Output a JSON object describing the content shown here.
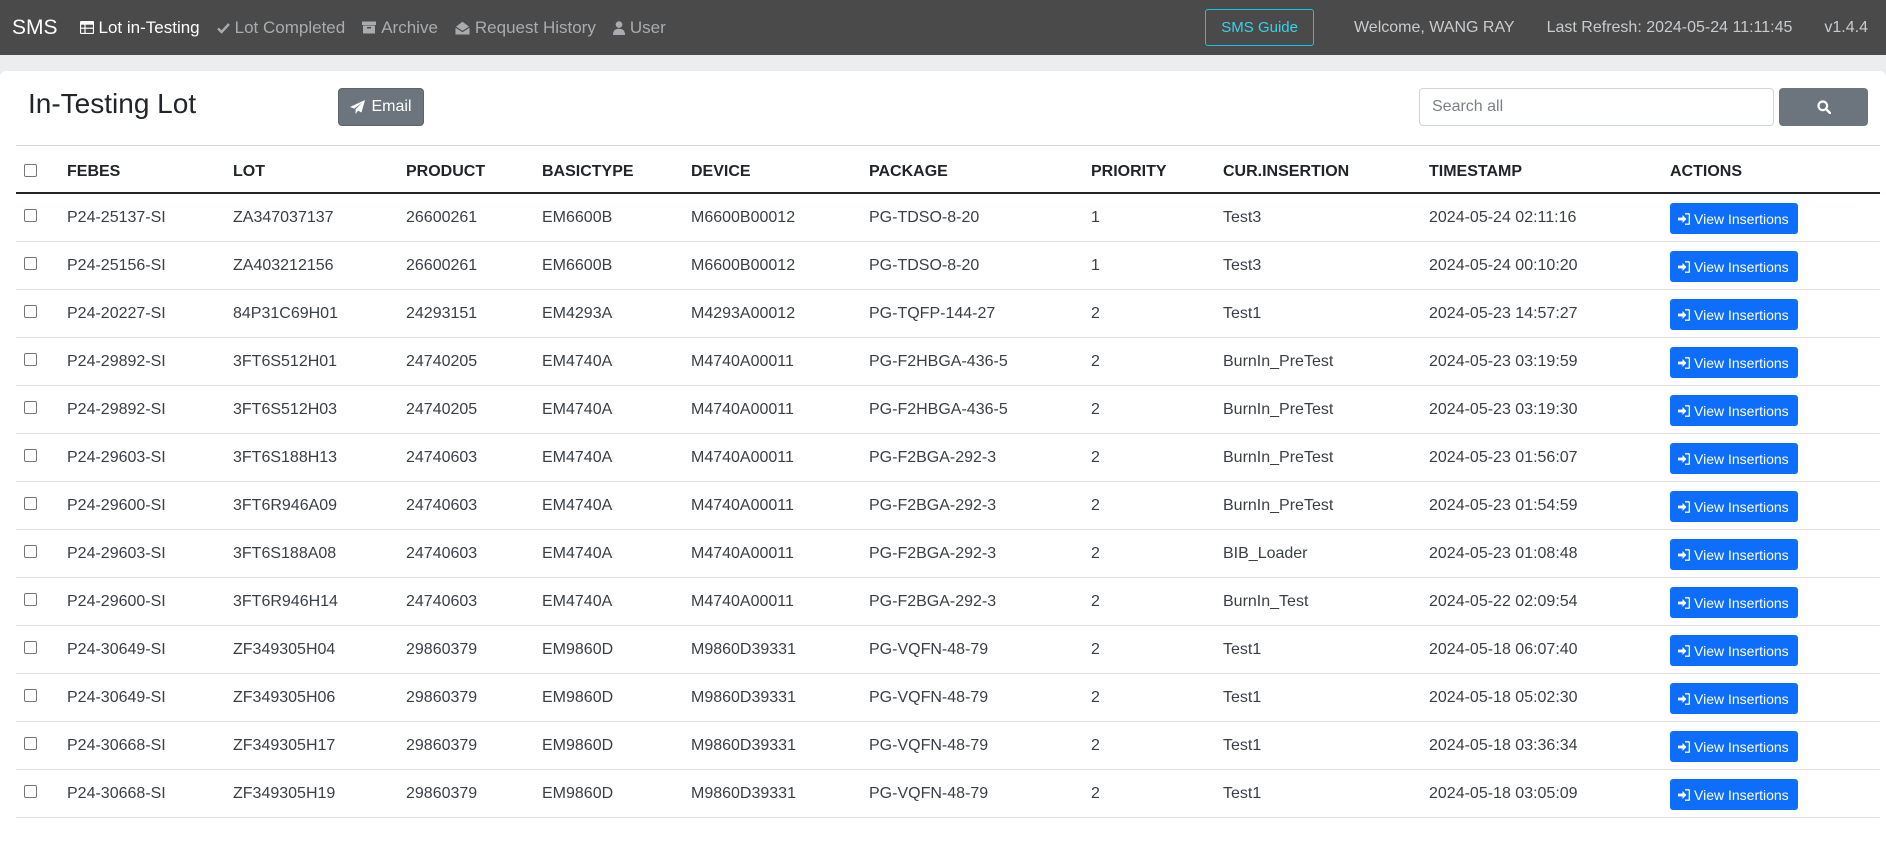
{
  "navbar": {
    "brand": "SMS",
    "items": [
      {
        "label": "Lot in-Testing",
        "icon": "table-icon"
      },
      {
        "label": "Lot Completed",
        "icon": "check-icon"
      },
      {
        "label": "Archive",
        "icon": "archive-icon"
      },
      {
        "label": "Request History",
        "icon": "envelope-open-icon"
      },
      {
        "label": "User",
        "icon": "user-icon"
      }
    ],
    "guide_label": "SMS Guide",
    "welcome": "Welcome, WANG RAY",
    "last_refresh": "Last Refresh: 2024-05-24 11:11:45",
    "version": "v1.4.4"
  },
  "page": {
    "title": "In-Testing Lot",
    "email_label": "Email",
    "search_placeholder": "Search all"
  },
  "table": {
    "headers": [
      "FEBES",
      "LOT",
      "PRODUCT",
      "BASICTYPE",
      "DEVICE",
      "PACKAGE",
      "PRIORITY",
      "CUR.INSERTION",
      "TIMESTAMP",
      "ACTIONS"
    ],
    "action_label": "View Insertions",
    "rows": [
      [
        "P24-25137-SI",
        "ZA347037137",
        "26600261",
        "EM6600B",
        "M6600B00012",
        "PG-TDSO-8-20",
        "1",
        "Test3",
        "2024-05-24 02:11:16"
      ],
      [
        "P24-25156-SI",
        "ZA403212156",
        "26600261",
        "EM6600B",
        "M6600B00012",
        "PG-TDSO-8-20",
        "1",
        "Test3",
        "2024-05-24 00:10:20"
      ],
      [
        "P24-20227-SI",
        "84P31C69H01",
        "24293151",
        "EM4293A",
        "M4293A00012",
        "PG-TQFP-144-27",
        "2",
        "Test1",
        "2024-05-23 14:57:27"
      ],
      [
        "P24-29892-SI",
        "3FT6S512H01",
        "24740205",
        "EM4740A",
        "M4740A00011",
        "PG-F2HBGA-436-5",
        "2",
        "BurnIn_PreTest",
        "2024-05-23 03:19:59"
      ],
      [
        "P24-29892-SI",
        "3FT6S512H03",
        "24740205",
        "EM4740A",
        "M4740A00011",
        "PG-F2HBGA-436-5",
        "2",
        "BurnIn_PreTest",
        "2024-05-23 03:19:30"
      ],
      [
        "P24-29603-SI",
        "3FT6S188H13",
        "24740603",
        "EM4740A",
        "M4740A00011",
        "PG-F2BGA-292-3",
        "2",
        "BurnIn_PreTest",
        "2024-05-23 01:56:07"
      ],
      [
        "P24-29600-SI",
        "3FT6R946A09",
        "24740603",
        "EM4740A",
        "M4740A00011",
        "PG-F2BGA-292-3",
        "2",
        "BurnIn_PreTest",
        "2024-05-23 01:54:59"
      ],
      [
        "P24-29603-SI",
        "3FT6S188A08",
        "24740603",
        "EM4740A",
        "M4740A00011",
        "PG-F2BGA-292-3",
        "2",
        "BIB_Loader",
        "2024-05-23 01:08:48"
      ],
      [
        "P24-29600-SI",
        "3FT6R946H14",
        "24740603",
        "EM4740A",
        "M4740A00011",
        "PG-F2BGA-292-3",
        "2",
        "BurnIn_Test",
        "2024-05-22 02:09:54"
      ],
      [
        "P24-30649-SI",
        "ZF349305H04",
        "29860379",
        "EM9860D",
        "M9860D39331",
        "PG-VQFN-48-79",
        "2",
        "Test1",
        "2024-05-18 06:07:40"
      ],
      [
        "P24-30649-SI",
        "ZF349305H06",
        "29860379",
        "EM9860D",
        "M9860D39331",
        "PG-VQFN-48-79",
        "2",
        "Test1",
        "2024-05-18 05:02:30"
      ],
      [
        "P24-30668-SI",
        "ZF349305H17",
        "29860379",
        "EM9860D",
        "M9860D39331",
        "PG-VQFN-48-79",
        "2",
        "Test1",
        "2024-05-18 03:36:34"
      ],
      [
        "P24-30668-SI",
        "ZF349305H19",
        "29860379",
        "EM9860D",
        "M9860D39331",
        "PG-VQFN-48-79",
        "2",
        "Test1",
        "2024-05-18 03:05:09"
      ]
    ]
  },
  "colors": {
    "navbar_bg": "#4a4a4a",
    "accent_info": "#17c1e8",
    "primary": "#0d6efd",
    "secondary": "#6c757d"
  }
}
